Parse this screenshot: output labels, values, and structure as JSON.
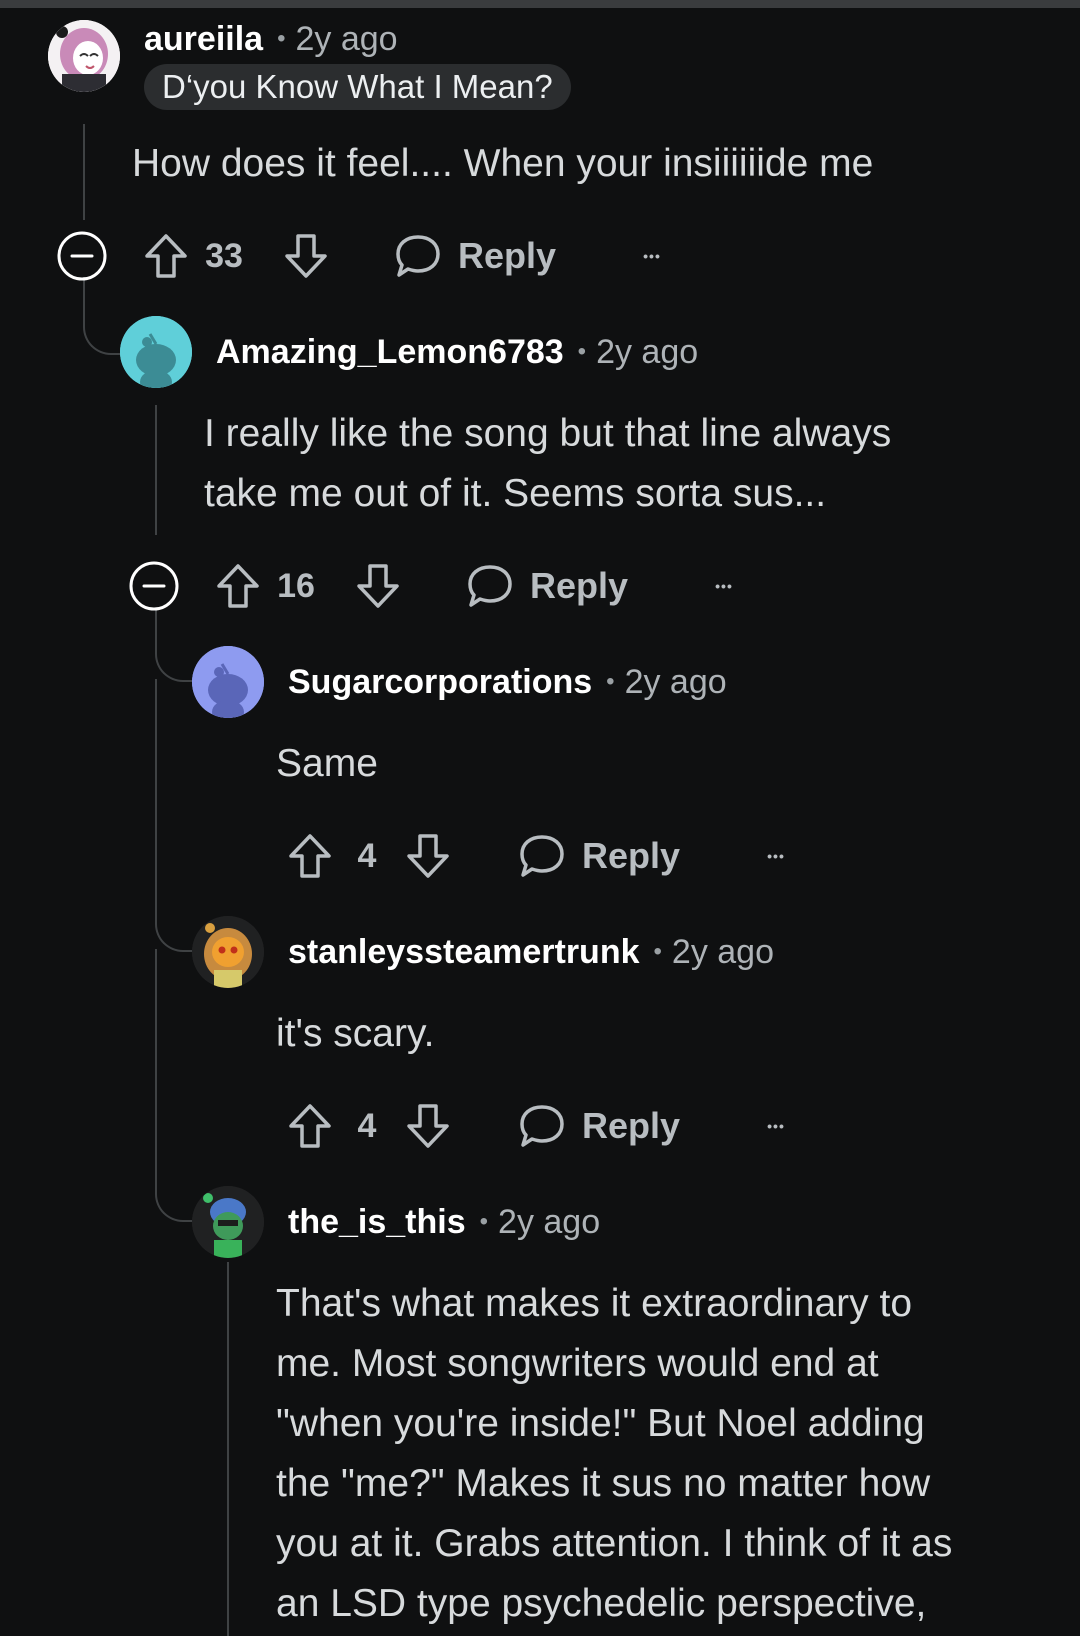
{
  "comments": [
    {
      "username": "aureiila",
      "separator": "•",
      "time": "2y ago",
      "flair": "D‘you Know What I Mean?",
      "body": "How does it feel.... When your insiiiiiide me",
      "votes": "33",
      "reply_label": "Reply",
      "more": "•••"
    },
    {
      "username": "Amazing_Lemon6783",
      "separator": "•",
      "time": "2y ago",
      "body_lines": [
        "I really like the song but that line always",
        "take me out of it. Seems sorta sus..."
      ],
      "votes": "16",
      "reply_label": "Reply",
      "more": "•••"
    },
    {
      "username": "Sugarcorporations",
      "separator": "•",
      "time": "2y ago",
      "body": "Same",
      "votes": "4",
      "reply_label": "Reply",
      "more": "•••"
    },
    {
      "username": "stanleyssteamertrunk",
      "separator": "•",
      "time": "2y ago",
      "body": "it's scary.",
      "votes": "4",
      "reply_label": "Reply",
      "more": "•••"
    },
    {
      "username": "the_is_this",
      "separator": "•",
      "time": "2y ago",
      "body_lines": [
        "That's what makes it extraordinary to",
        "me. Most songwriters would end at",
        "\"when you're inside!\" But Noel adding",
        "the \"me?\" Makes it sus no matter how",
        "you at it. Grabs attention. I think of it as",
        "an LSD type psychedelic perspective,"
      ]
    }
  ],
  "colors": {
    "background": "#0f1011",
    "text": "#d7dadc",
    "username": "#ffffff",
    "muted": "#aeb3b7",
    "thread_line": "#3f4244"
  },
  "icons": {
    "collapse": "minus-circle-icon",
    "upvote": "arrow-up-icon",
    "downvote": "arrow-down-icon",
    "reply": "speech-bubble-icon",
    "more": "ellipsis-icon"
  }
}
